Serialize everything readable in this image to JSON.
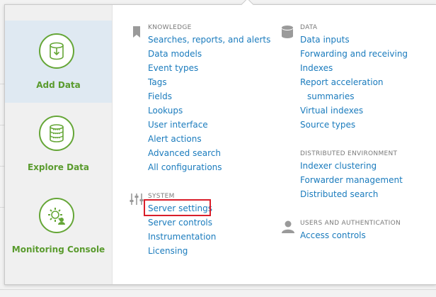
{
  "tiles": [
    {
      "label": "Add Data",
      "icon": "add-data-icon",
      "active": true
    },
    {
      "label": "Explore Data",
      "icon": "explore-data-icon",
      "active": false
    },
    {
      "label": "Monitoring Console",
      "icon": "monitoring-console-icon",
      "active": false
    }
  ],
  "knowledge": {
    "heading": "KNOWLEDGE",
    "icon": "bookmark-icon",
    "links": [
      "Searches, reports, and alerts",
      "Data models",
      "Event types",
      "Tags",
      "Fields",
      "Lookups",
      "User interface",
      "Alert actions",
      "Advanced search",
      "All configurations"
    ]
  },
  "system": {
    "heading": "SYSTEM",
    "icon": "sliders-icon",
    "links": [
      "Server settings",
      "Server controls",
      "Instrumentation",
      "Licensing"
    ]
  },
  "data": {
    "heading": "DATA",
    "icon": "database-icon",
    "links": [
      "Data inputs",
      "Forwarding and receiving",
      "Indexes",
      "Report acceleration",
      "summaries",
      "Virtual indexes",
      "Source types"
    ]
  },
  "distributed": {
    "heading": "DISTRIBUTED ENVIRONMENT",
    "links": [
      "Indexer clustering",
      "Forwarder management",
      "Distributed search"
    ]
  },
  "users": {
    "heading": "USERS AND AUTHENTICATION",
    "icon": "user-icon",
    "links": [
      "Access controls"
    ]
  },
  "colors": {
    "accent_green": "#65a637",
    "link_blue": "#1a7bbd",
    "highlight_red": "#d91e2a",
    "active_tile_bg": "#dfe9f2"
  }
}
